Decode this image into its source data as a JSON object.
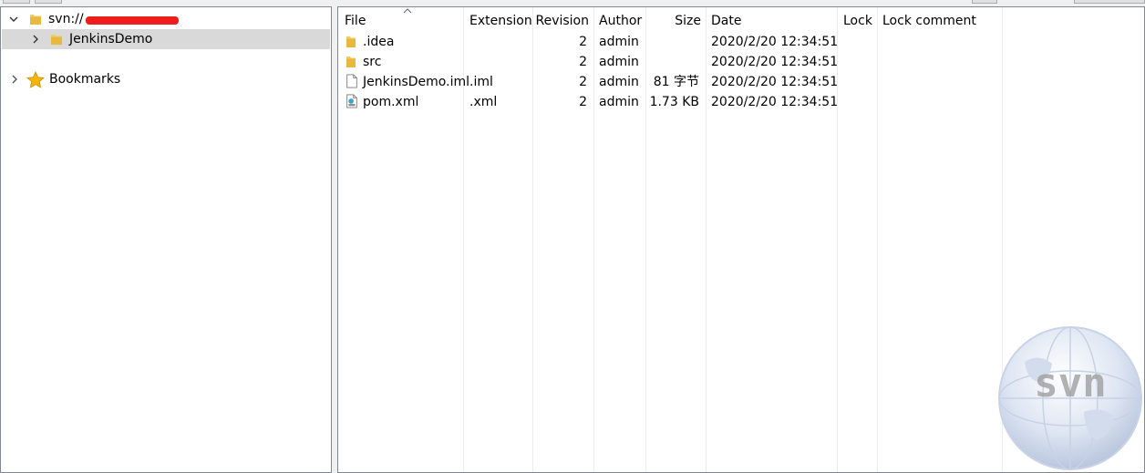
{
  "tree": {
    "root": {
      "label_visible": "svn://",
      "expanded": true
    },
    "child": {
      "label": "JenkinsDemo",
      "selected": true
    },
    "bookmarks": {
      "label": "Bookmarks"
    }
  },
  "file_list": {
    "columns": [
      "File",
      "Extension",
      "Revision",
      "Author",
      "Size",
      "Date",
      "Lock",
      "Lock comment"
    ],
    "rows": [
      {
        "name": ".idea",
        "extension": "",
        "revision": "2",
        "author": "admin",
        "size": "",
        "date": "2020/2/20 12:34:51",
        "icon": "folder-icon"
      },
      {
        "name": "src",
        "extension": "",
        "revision": "2",
        "author": "admin",
        "size": "",
        "date": "2020/2/20 12:34:51",
        "icon": "folder-icon"
      },
      {
        "name": "JenkinsDemo.iml",
        "extension": ".iml",
        "revision": "2",
        "author": "admin",
        "size": "81 字节",
        "date": "2020/2/20 12:34:51",
        "icon": "file-icon"
      },
      {
        "name": "pom.xml",
        "extension": ".xml",
        "revision": "2",
        "author": "admin",
        "size": "1.73 KB",
        "date": "2020/2/20 12:34:51",
        "icon": "xml-file-icon"
      }
    ]
  },
  "watermark": {
    "text": "svn"
  },
  "colors": {
    "selection": "#d9d9d9",
    "folder": "#e8c25a",
    "redaction": "#ee1c1c",
    "border": "#828790"
  }
}
